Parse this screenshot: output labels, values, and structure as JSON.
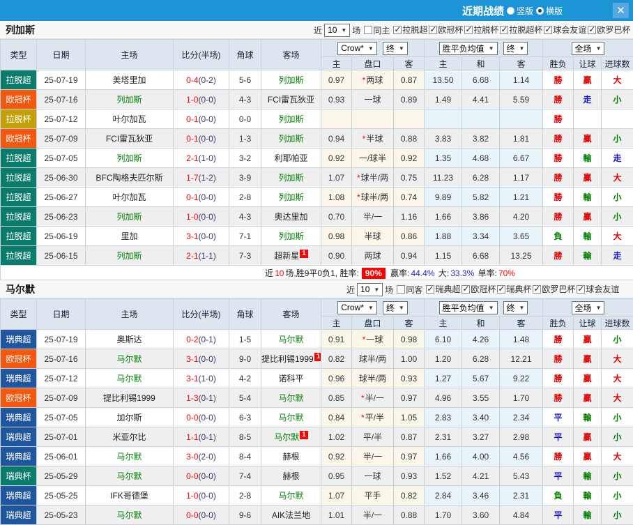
{
  "titlebar": {
    "title": "近期战绩",
    "radio_vertical": "竖版",
    "radio_horizontal": "横版",
    "close": "✕"
  },
  "labels": {
    "near": "近",
    "games": "场"
  },
  "table": {
    "cols": [
      "类型",
      "日期",
      "主场",
      "比分(半场)",
      "角球",
      "客场"
    ],
    "sub": [
      "主",
      "盘口",
      "客",
      "主",
      "和",
      "客",
      "胜负",
      "让球",
      "进球数"
    ],
    "dd_crow": "Crow*",
    "dd_final": "终",
    "dd_mean": "胜平负均值",
    "dd_scope": "全场"
  },
  "badge_colors": {
    "teal": "#0b7c6c",
    "orange": "#f4570e",
    "yellow": "#c3a008",
    "blue": "#20569d"
  },
  "result_colors": {
    "red": "#e60000",
    "green": "#008000",
    "blue": "#1414cc"
  },
  "sections": [
    {
      "team": "列加斯",
      "count": "10",
      "same_label": "同主",
      "competitions": [
        "拉脱超",
        "欧冠杯",
        "拉脱杯",
        "拉脱超杯",
        "球会友谊",
        "欧罗巴杯"
      ],
      "rows": [
        {
          "comp": "拉脱超",
          "comp_color": "teal",
          "date": "25-07-19",
          "home": {
            "name": "美塔里加",
            "tracked": false
          },
          "score": {
            "ft": "0-4",
            "ht": "(0-2)"
          },
          "corner": "5-6",
          "away": {
            "name": "列加斯",
            "tracked": true
          },
          "crow": {
            "home": "0.97",
            "star": true,
            "plate": "两球",
            "away": "0.87"
          },
          "mean": {
            "home": "13.50",
            "draw": "6.68",
            "away": "1.14"
          },
          "result": {
            "wdl": "勝",
            "wdl_c": "red",
            "handicap": "贏",
            "handicap_c": "red",
            "goals": "大",
            "goals_c": "red"
          }
        },
        {
          "comp": "欧冠杯",
          "comp_color": "orange",
          "date": "25-07-16",
          "home": {
            "name": "列加斯",
            "tracked": true
          },
          "score": {
            "ft": "1-0",
            "ht": "(0-0)"
          },
          "corner": "4-3",
          "away": {
            "name": "FCI雷瓦狄亚",
            "tracked": false
          },
          "crow": {
            "home": "0.93",
            "star": false,
            "plate": "一球",
            "away": "0.89"
          },
          "mean": {
            "home": "1.49",
            "draw": "4.41",
            "away": "5.59"
          },
          "result": {
            "wdl": "勝",
            "wdl_c": "red",
            "handicap": "走",
            "handicap_c": "blue",
            "goals": "小",
            "goals_c": "green"
          }
        },
        {
          "comp": "拉脱杯",
          "comp_color": "yellow",
          "date": "25-07-12",
          "home": {
            "name": "叶尔加瓦",
            "tracked": false
          },
          "score": {
            "ft": "0-1",
            "ht": "(0-0)"
          },
          "corner": "0-0",
          "away": {
            "name": "列加斯",
            "tracked": true
          },
          "crow": {
            "home": "",
            "star": false,
            "plate": "",
            "away": ""
          },
          "mean": {
            "home": "",
            "draw": "",
            "away": ""
          },
          "result": {
            "wdl": "勝",
            "wdl_c": "red",
            "handicap": "",
            "handicap_c": "",
            "goals": "",
            "goals_c": ""
          }
        },
        {
          "comp": "欧冠杯",
          "comp_color": "orange",
          "date": "25-07-09",
          "home": {
            "name": "FCI雷瓦狄亚",
            "tracked": false
          },
          "score": {
            "ft": "0-1",
            "ht": "(0-0)"
          },
          "corner": "1-3",
          "away": {
            "name": "列加斯",
            "tracked": true
          },
          "crow": {
            "home": "0.94",
            "star": true,
            "plate": "半球",
            "away": "0.88"
          },
          "mean": {
            "home": "3.83",
            "draw": "3.82",
            "away": "1.81"
          },
          "result": {
            "wdl": "勝",
            "wdl_c": "red",
            "handicap": "贏",
            "handicap_c": "red",
            "goals": "小",
            "goals_c": "green"
          }
        },
        {
          "comp": "拉脱超",
          "comp_color": "teal",
          "date": "25-07-05",
          "home": {
            "name": "列加斯",
            "tracked": true
          },
          "score": {
            "ft": "2-1",
            "ht": "(1-0)"
          },
          "corner": "3-2",
          "away": {
            "name": "利耶帕亚",
            "tracked": false
          },
          "crow": {
            "home": "0.92",
            "star": false,
            "plate": "一/球半",
            "away": "0.92"
          },
          "mean": {
            "home": "1.35",
            "draw": "4.68",
            "away": "6.67"
          },
          "result": {
            "wdl": "勝",
            "wdl_c": "red",
            "handicap": "輸",
            "handicap_c": "green",
            "goals": "走",
            "goals_c": "blue"
          }
        },
        {
          "comp": "拉脱超",
          "comp_color": "teal",
          "date": "25-06-30",
          "home": {
            "name": "BFC陶格夫匹尔斯",
            "tracked": false
          },
          "score": {
            "ft": "1-7",
            "ht": "(1-2)"
          },
          "corner": "3-9",
          "away": {
            "name": "列加斯",
            "tracked": true
          },
          "crow": {
            "home": "1.07",
            "star": true,
            "plate": "球半/两",
            "away": "0.75"
          },
          "mean": {
            "home": "11.23",
            "draw": "6.28",
            "away": "1.17"
          },
          "result": {
            "wdl": "勝",
            "wdl_c": "red",
            "handicap": "贏",
            "handicap_c": "red",
            "goals": "大",
            "goals_c": "red"
          }
        },
        {
          "comp": "拉脱超",
          "comp_color": "teal",
          "date": "25-06-27",
          "home": {
            "name": "叶尔加瓦",
            "tracked": false
          },
          "score": {
            "ft": "0-1",
            "ht": "(0-0)"
          },
          "corner": "2-8",
          "away": {
            "name": "列加斯",
            "tracked": true
          },
          "crow": {
            "home": "1.08",
            "star": true,
            "plate": "球半/两",
            "away": "0.74"
          },
          "mean": {
            "home": "9.89",
            "draw": "5.82",
            "away": "1.21"
          },
          "result": {
            "wdl": "勝",
            "wdl_c": "red",
            "handicap": "輸",
            "handicap_c": "green",
            "goals": "小",
            "goals_c": "green"
          }
        },
        {
          "comp": "拉脱超",
          "comp_color": "teal",
          "date": "25-06-23",
          "home": {
            "name": "列加斯",
            "tracked": true
          },
          "score": {
            "ft": "1-0",
            "ht": "(0-0)"
          },
          "corner": "4-3",
          "away": {
            "name": "奥达里加",
            "tracked": false
          },
          "crow": {
            "home": "0.70",
            "star": false,
            "plate": "半/一",
            "away": "1.16"
          },
          "mean": {
            "home": "1.66",
            "draw": "3.86",
            "away": "4.20"
          },
          "result": {
            "wdl": "勝",
            "wdl_c": "red",
            "handicap": "贏",
            "handicap_c": "red",
            "goals": "小",
            "goals_c": "green"
          }
        },
        {
          "comp": "拉脱超",
          "comp_color": "teal",
          "date": "25-06-19",
          "home": {
            "name": "里加",
            "tracked": false
          },
          "score": {
            "ft": "3-1",
            "ht": "(0-0)"
          },
          "corner": "7-1",
          "away": {
            "name": "列加斯",
            "tracked": true
          },
          "crow": {
            "home": "0.98",
            "star": false,
            "plate": "半球",
            "away": "0.86"
          },
          "mean": {
            "home": "1.88",
            "draw": "3.34",
            "away": "3.65"
          },
          "result": {
            "wdl": "負",
            "wdl_c": "green",
            "handicap": "輸",
            "handicap_c": "green",
            "goals": "大",
            "goals_c": "red"
          }
        },
        {
          "comp": "拉脱超",
          "comp_color": "teal",
          "date": "25-06-15",
          "home": {
            "name": "列加斯",
            "tracked": true
          },
          "score": {
            "ft": "2-1",
            "ht": "(1-1)"
          },
          "corner": "7-3",
          "away": {
            "name": "超新星",
            "tracked": false,
            "redcard": "1"
          },
          "crow": {
            "home": "0.90",
            "star": false,
            "plate": "两球",
            "away": "0.94"
          },
          "mean": {
            "home": "1.15",
            "draw": "6.68",
            "away": "13.25"
          },
          "result": {
            "wdl": "勝",
            "wdl_c": "red",
            "handicap": "輸",
            "handicap_c": "green",
            "goals": "走",
            "goals_c": "blue"
          }
        }
      ],
      "summary": {
        "near": "近",
        "count": "10",
        "text": "场,胜9平0负1, 胜率:",
        "win_rate": "90%",
        "profit_label": "赢率:",
        "profit": "44.4%",
        "big_label": "大:",
        "big": "33.3%",
        "single_label": "单率:",
        "single": "70%"
      }
    },
    {
      "team": "马尔默",
      "count": "10",
      "same_label": "同客",
      "competitions": [
        "瑞典超",
        "欧冠杯",
        "瑞典杯",
        "欧罗巴杯",
        "球会友谊"
      ],
      "rows": [
        {
          "comp": "瑞典超",
          "comp_color": "blue",
          "date": "25-07-19",
          "home": {
            "name": "奥斯达",
            "tracked": false
          },
          "score": {
            "ft": "0-2",
            "ht": "(0-1)"
          },
          "corner": "1-5",
          "away": {
            "name": "马尔默",
            "tracked": true
          },
          "crow": {
            "home": "0.91",
            "star": true,
            "plate": "一球",
            "away": "0.98"
          },
          "mean": {
            "home": "6.10",
            "draw": "4.26",
            "away": "1.48"
          },
          "result": {
            "wdl": "勝",
            "wdl_c": "red",
            "handicap": "贏",
            "handicap_c": "red",
            "goals": "小",
            "goals_c": "green"
          }
        },
        {
          "comp": "欧冠杯",
          "comp_color": "orange",
          "date": "25-07-16",
          "home": {
            "name": "马尔默",
            "tracked": true
          },
          "score": {
            "ft": "3-1",
            "ht": "(0-0)"
          },
          "corner": "9-0",
          "away": {
            "name": "提比利锡1999",
            "tracked": false,
            "redcard": "1"
          },
          "crow": {
            "home": "0.82",
            "star": false,
            "plate": "球半/两",
            "away": "1.00"
          },
          "mean": {
            "home": "1.20",
            "draw": "6.28",
            "away": "12.21"
          },
          "result": {
            "wdl": "勝",
            "wdl_c": "red",
            "handicap": "贏",
            "handicap_c": "red",
            "goals": "大",
            "goals_c": "red"
          }
        },
        {
          "comp": "瑞典超",
          "comp_color": "blue",
          "date": "25-07-12",
          "home": {
            "name": "马尔默",
            "tracked": true
          },
          "score": {
            "ft": "3-1",
            "ht": "(1-0)"
          },
          "corner": "4-2",
          "away": {
            "name": "诺科平",
            "tracked": false
          },
          "crow": {
            "home": "0.96",
            "star": false,
            "plate": "球半/两",
            "away": "0.93"
          },
          "mean": {
            "home": "1.27",
            "draw": "5.67",
            "away": "9.22"
          },
          "result": {
            "wdl": "勝",
            "wdl_c": "red",
            "handicap": "贏",
            "handicap_c": "red",
            "goals": "大",
            "goals_c": "red"
          }
        },
        {
          "comp": "欧冠杯",
          "comp_color": "orange",
          "date": "25-07-09",
          "home": {
            "name": "提比利锡1999",
            "tracked": false
          },
          "score": {
            "ft": "1-3",
            "ht": "(0-1)"
          },
          "corner": "5-4",
          "away": {
            "name": "马尔默",
            "tracked": true
          },
          "crow": {
            "home": "0.85",
            "star": true,
            "plate": "半/一",
            "away": "0.97"
          },
          "mean": {
            "home": "4.96",
            "draw": "3.55",
            "away": "1.70"
          },
          "result": {
            "wdl": "勝",
            "wdl_c": "red",
            "handicap": "贏",
            "handicap_c": "red",
            "goals": "大",
            "goals_c": "red"
          }
        },
        {
          "comp": "瑞典超",
          "comp_color": "blue",
          "date": "25-07-05",
          "home": {
            "name": "加尔斯",
            "tracked": false
          },
          "score": {
            "ft": "0-0",
            "ht": "(0-0)"
          },
          "corner": "6-3",
          "away": {
            "name": "马尔默",
            "tracked": true
          },
          "crow": {
            "home": "0.84",
            "star": true,
            "plate": "平/半",
            "away": "1.05"
          },
          "mean": {
            "home": "2.83",
            "draw": "3.40",
            "away": "2.34"
          },
          "result": {
            "wdl": "平",
            "wdl_c": "blue",
            "handicap": "輸",
            "handicap_c": "green",
            "goals": "小",
            "goals_c": "green"
          }
        },
        {
          "comp": "瑞典超",
          "comp_color": "blue",
          "date": "25-07-01",
          "home": {
            "name": "米亚尔比",
            "tracked": false
          },
          "score": {
            "ft": "1-1",
            "ht": "(0-1)"
          },
          "corner": "8-5",
          "away": {
            "name": "马尔默",
            "tracked": true,
            "redcard": "1"
          },
          "crow": {
            "home": "1.02",
            "star": false,
            "plate": "平/半",
            "away": "0.87"
          },
          "mean": {
            "home": "2.31",
            "draw": "3.27",
            "away": "2.98"
          },
          "result": {
            "wdl": "平",
            "wdl_c": "blue",
            "handicap": "贏",
            "handicap_c": "red",
            "goals": "小",
            "goals_c": "green"
          }
        },
        {
          "comp": "瑞典超",
          "comp_color": "blue",
          "date": "25-06-01",
          "home": {
            "name": "马尔默",
            "tracked": true
          },
          "score": {
            "ft": "3-0",
            "ht": "(2-0)"
          },
          "corner": "8-4",
          "away": {
            "name": "赫根",
            "tracked": false
          },
          "crow": {
            "home": "0.92",
            "star": false,
            "plate": "半/一",
            "away": "0.97"
          },
          "mean": {
            "home": "1.66",
            "draw": "4.00",
            "away": "4.56"
          },
          "result": {
            "wdl": "勝",
            "wdl_c": "red",
            "handicap": "贏",
            "handicap_c": "red",
            "goals": "大",
            "goals_c": "red"
          }
        },
        {
          "comp": "瑞典杯",
          "comp_color": "teal",
          "date": "25-05-29",
          "home": {
            "name": "马尔默",
            "tracked": true
          },
          "score": {
            "ft": "0-0",
            "ht": "(0-0)"
          },
          "corner": "7-4",
          "away": {
            "name": "赫根",
            "tracked": false
          },
          "crow": {
            "home": "0.95",
            "star": false,
            "plate": "一球",
            "away": "0.93"
          },
          "mean": {
            "home": "1.52",
            "draw": "4.21",
            "away": "5.43"
          },
          "result": {
            "wdl": "平",
            "wdl_c": "blue",
            "handicap": "輸",
            "handicap_c": "green",
            "goals": "小",
            "goals_c": "green"
          }
        },
        {
          "comp": "瑞典超",
          "comp_color": "blue",
          "date": "25-05-25",
          "home": {
            "name": "IFK哥德堡",
            "tracked": false
          },
          "score": {
            "ft": "1-0",
            "ht": "(0-0)"
          },
          "corner": "2-8",
          "away": {
            "name": "马尔默",
            "tracked": true
          },
          "crow": {
            "home": "1.07",
            "star": false,
            "plate": "平手",
            "away": "0.82"
          },
          "mean": {
            "home": "2.84",
            "draw": "3.46",
            "away": "2.31"
          },
          "result": {
            "wdl": "負",
            "wdl_c": "green",
            "handicap": "輸",
            "handicap_c": "green",
            "goals": "小",
            "goals_c": "green"
          }
        },
        {
          "comp": "瑞典超",
          "comp_color": "blue",
          "date": "25-05-23",
          "home": {
            "name": "马尔默",
            "tracked": true
          },
          "score": {
            "ft": "0-0",
            "ht": "(0-0)"
          },
          "corner": "9-6",
          "away": {
            "name": "AIK法兰地",
            "tracked": false
          },
          "crow": {
            "home": "1.01",
            "star": false,
            "plate": "半/一",
            "away": "0.88"
          },
          "mean": {
            "home": "1.70",
            "draw": "3.60",
            "away": "4.84"
          },
          "result": {
            "wdl": "平",
            "wdl_c": "blue",
            "handicap": "輸",
            "handicap_c": "green",
            "goals": "小",
            "goals_c": "green"
          }
        }
      ]
    }
  ]
}
